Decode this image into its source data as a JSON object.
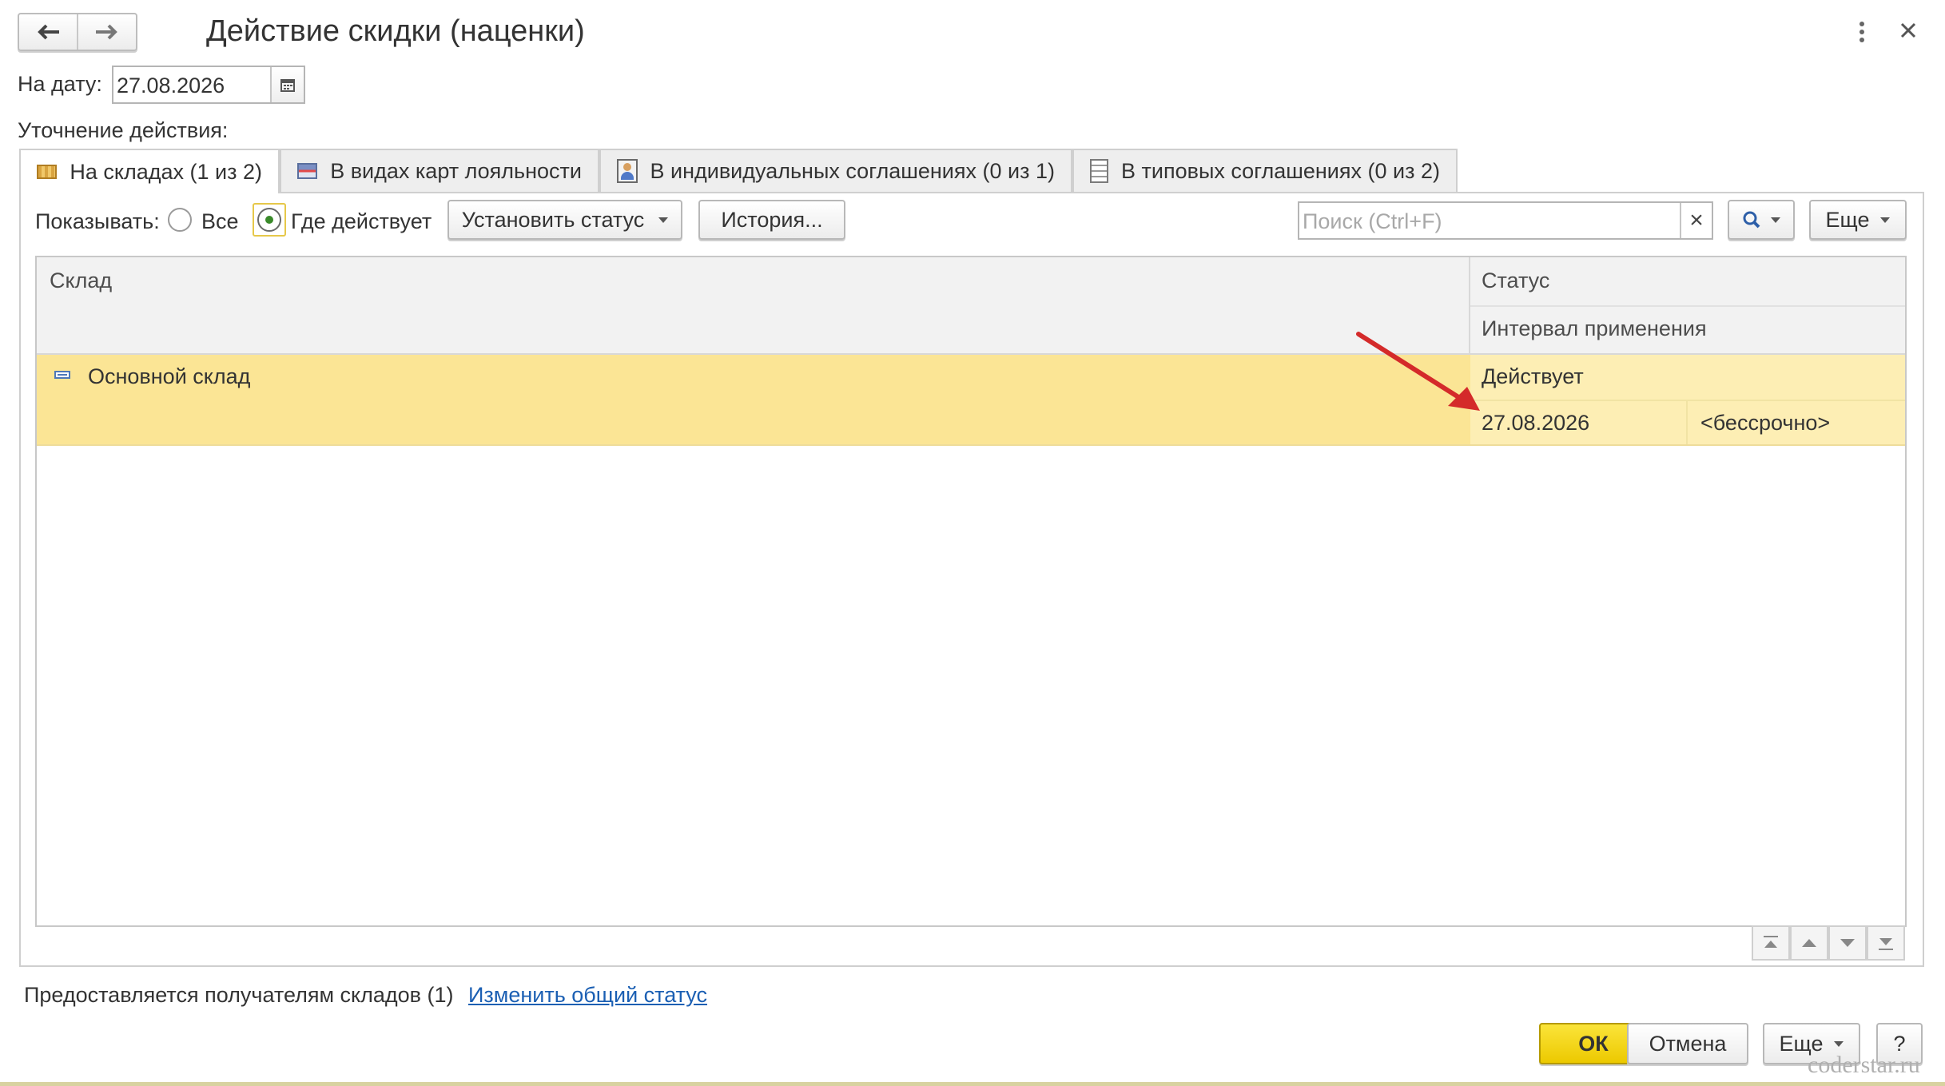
{
  "window": {
    "title": "Действие скидки (наценки)"
  },
  "date": {
    "label": "На дату:",
    "value": "27.08.2026"
  },
  "section_label": "Уточнение действия:",
  "tabs": [
    {
      "label": "На складах (1 из 2)",
      "active": true,
      "icon": "warehouse-icon"
    },
    {
      "label": "В видах карт лояльности",
      "active": false,
      "icon": "loyalty-card-icon"
    },
    {
      "label": "В индивидуальных соглашениях (0 из 1)",
      "active": false,
      "icon": "person-agreement-icon"
    },
    {
      "label": "В типовых соглашениях (0 из 2)",
      "active": false,
      "icon": "document-icon"
    }
  ],
  "toolbar": {
    "show_label": "Показывать:",
    "radio_all": "Все",
    "radio_active": "Где действует",
    "set_status": "Установить статус",
    "history": "История...",
    "search_placeholder": "Поиск (Ctrl+F)",
    "search_clear": "×",
    "more": "Еще"
  },
  "grid": {
    "col_warehouse": "Склад",
    "col_status": "Статус",
    "col_interval": "Интервал применения",
    "rows": [
      {
        "warehouse": "Основной склад",
        "status": "Действует",
        "from": "27.08.2026",
        "to": "<бессрочно>"
      }
    ]
  },
  "footer": {
    "info": "Предоставляется получателям складов (1)",
    "change_link": "Изменить общий статус",
    "ok": "ОК",
    "cancel": "Отмена",
    "more": "Еще",
    "help": "?"
  },
  "watermark": "coderstar.ru",
  "colors": {
    "selected_row": "#fbe595",
    "selected_cell": "#fdeeb4",
    "ok_button": "#f5d80c",
    "link": "#1b5fb3",
    "arrow": "#d42a2a"
  }
}
